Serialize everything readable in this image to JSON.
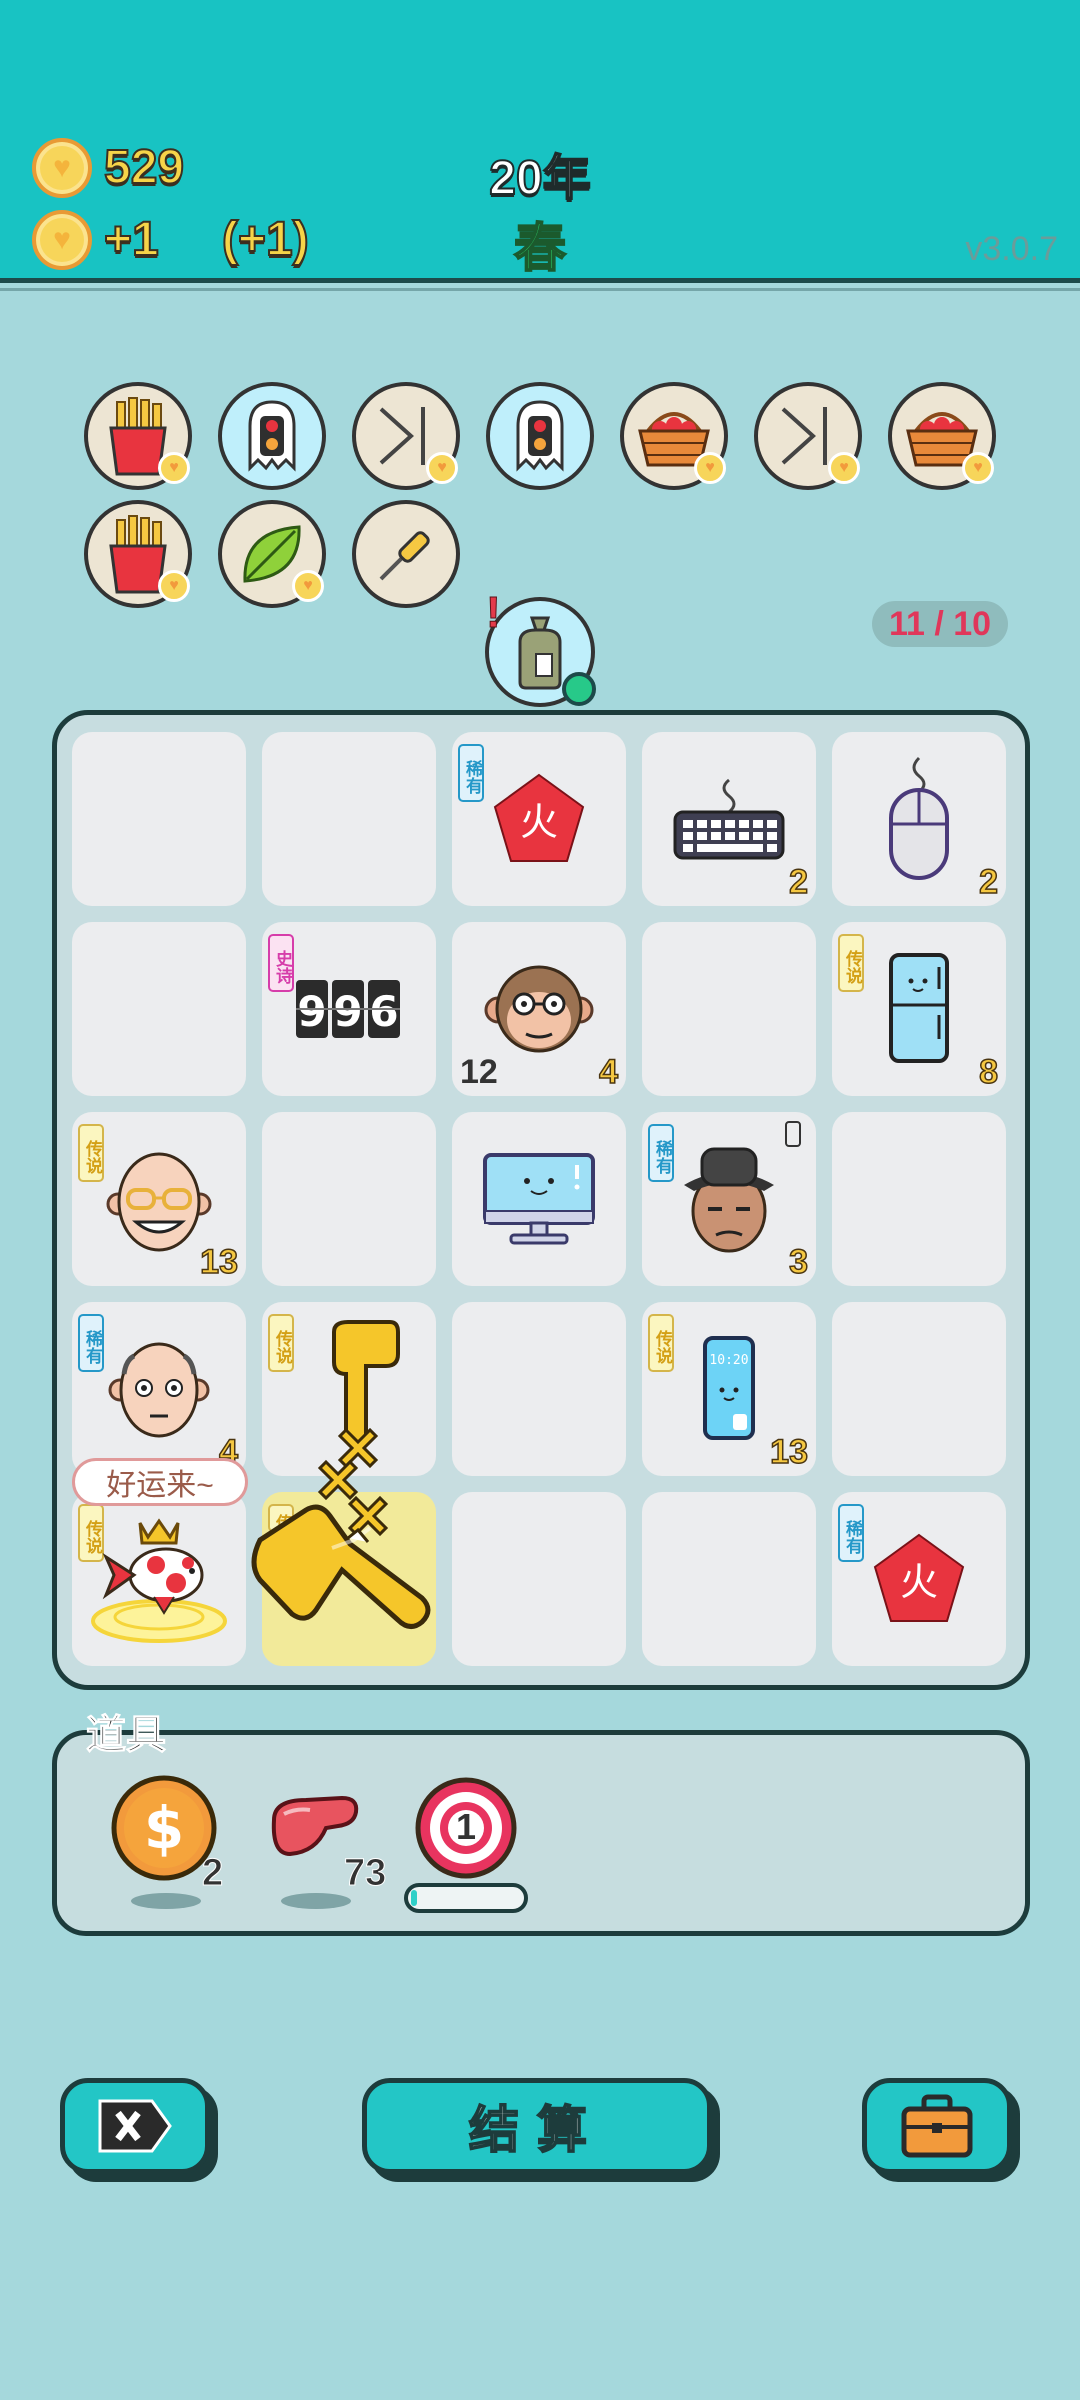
{
  "header": {
    "coins": "529",
    "income": "+1",
    "income_bonus": "(+1)",
    "year": "20年",
    "season": "春",
    "version": "v3.0.7"
  },
  "owned_items": [
    {
      "name": "fries",
      "icon": "fries-icon",
      "heart": true
    },
    {
      "name": "ghost-traffic-light",
      "icon": "ghost-icon",
      "heart": false
    },
    {
      "name": "next-arrow",
      "icon": "skip-icon",
      "heart": true
    },
    {
      "name": "ghost-traffic-light",
      "icon": "ghost-icon",
      "heart": false
    },
    {
      "name": "fruit-basket",
      "icon": "basket-icon",
      "heart": true
    },
    {
      "name": "next-arrow",
      "icon": "skip-icon",
      "heart": true
    },
    {
      "name": "fruit-basket",
      "icon": "basket-icon",
      "heart": true
    },
    {
      "name": "fries",
      "icon": "fries-icon",
      "heart": true
    },
    {
      "name": "leaf",
      "icon": "leaf-icon",
      "heart": true
    },
    {
      "name": "screwdriver",
      "icon": "screwdriver-icon",
      "heart": false
    }
  ],
  "bag": {
    "alert": "!",
    "counter": "11 / 10"
  },
  "board": {
    "cells": {
      "r0c2": {
        "rarity": "稀有",
        "glyph": "火",
        "value": ""
      },
      "r0c3": {
        "value": "2"
      },
      "r0c4": {
        "value": "2"
      },
      "r1c1": {
        "rarity": "史诗",
        "glyph": "996"
      },
      "r1c2": {
        "value": "4",
        "left_value": "12"
      },
      "r1c4": {
        "rarity": "传说",
        "value": "8"
      },
      "r2c0": {
        "rarity": "传说",
        "value": "13"
      },
      "r2c3": {
        "rarity": "稀有",
        "value": "3"
      },
      "r3c0": {
        "rarity": "稀有",
        "value": "4"
      },
      "r3c1": {
        "rarity": "传说"
      },
      "r3c3": {
        "rarity": "传说",
        "value": "13",
        "phone_time": "10:20"
      },
      "r4c0": {
        "rarity": "传说"
      },
      "r4c1": {
        "rarity": "传"
      },
      "r4c4": {
        "rarity": "稀有",
        "glyph": "火"
      }
    },
    "bubble": "好运来~"
  },
  "tools": {
    "title": "道具",
    "items": [
      {
        "icon": "coin-icon",
        "count": "2"
      },
      {
        "icon": "liver-icon",
        "count": "73"
      },
      {
        "icon": "target-icon",
        "count": "1",
        "progress": 0.05
      }
    ]
  },
  "buttons": {
    "close": "close-icon",
    "settle": "结算",
    "briefcase": "briefcase-icon"
  }
}
